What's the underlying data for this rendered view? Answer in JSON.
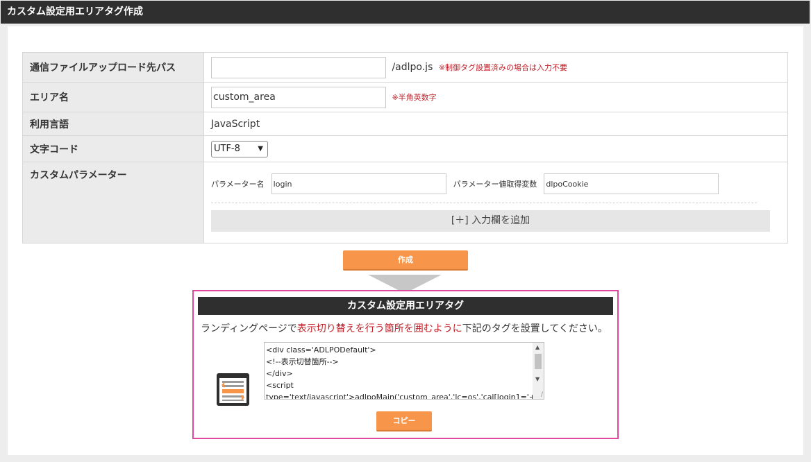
{
  "page": {
    "title": "カスタム設定用エリアタグ作成"
  },
  "form": {
    "upload_path": {
      "label": "通信ファイルアップロード先パス",
      "value": "",
      "suffix": "/adlpo.js",
      "note": "※制御タグ設置済みの場合は入力不要"
    },
    "area_name": {
      "label": "エリア名",
      "value": "custom_area",
      "note": "※半角英数字"
    },
    "language": {
      "label": "利用言語",
      "value": "JavaScript"
    },
    "charset": {
      "label": "文字コード",
      "selected": "UTF-8"
    },
    "custom_params": {
      "label": "カスタムパラメーター",
      "name_label": "パラメーター名",
      "name_value": "login",
      "value_label": "パラメーター値取得変数",
      "value_value": "dlpoCookie",
      "add_label": "[＋] 入力欄を追加"
    }
  },
  "create_button": "作成",
  "result": {
    "title": "カスタム設定用エリアタグ",
    "message_pre": "ランディングページで",
    "message_highlight": "表示切り替えを行う箇所を囲むように",
    "message_post": "下記のタグを設置してください。",
    "code": "<div class='ADLPODefault'>\n<!--表示切替箇所-->\n</div>\n<script\ntype='text/javascript'>adlpoMain('custom_area','lc=os','cal[login1='+",
    "copy_label": "コピー"
  },
  "colors": {
    "accent": "#f7964a",
    "alert": "#c01f28",
    "frame": "#e0479e",
    "header": "#2f2f2f"
  }
}
